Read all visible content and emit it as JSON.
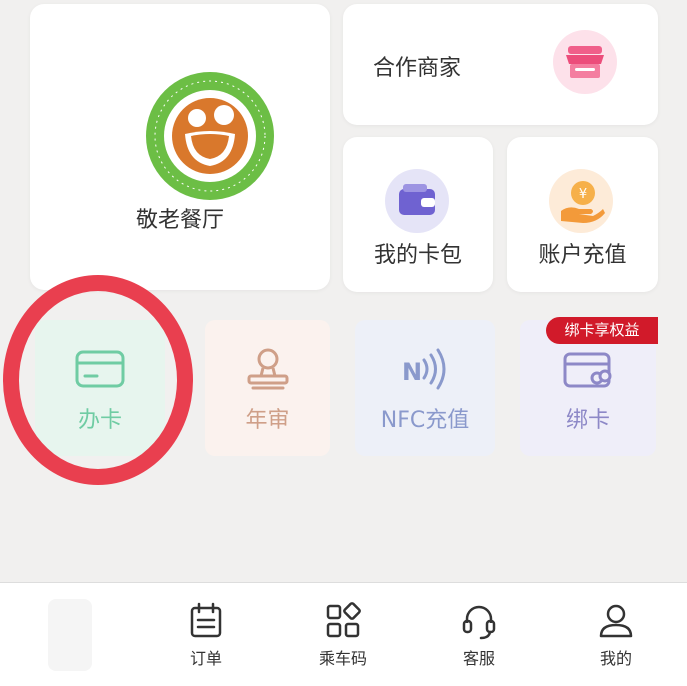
{
  "services": {
    "canteen": {
      "label": "敬老餐厅",
      "logo_icon": "elderly-canteen-logo"
    },
    "merchants": {
      "label": "合作商家",
      "icon": "shop-icon"
    },
    "wallet": {
      "label": "我的卡包",
      "icon": "wallet-icon"
    },
    "recharge": {
      "label": "账户充值",
      "icon": "coin-hand-icon"
    }
  },
  "quick_actions": {
    "apply_card": {
      "label": "办卡",
      "icon": "card-icon"
    },
    "annual_review": {
      "label": "年审",
      "icon": "stamp-icon"
    },
    "nfc_recharge": {
      "label": "NFC充值",
      "icon": "nfc-icon"
    },
    "bind_card": {
      "label": "绑卡",
      "icon": "card-link-icon"
    }
  },
  "promo_badge": "绑卡享权益",
  "tabbar": {
    "orders": {
      "label": "订单",
      "icon": "calendar-icon"
    },
    "ride_code": {
      "label": "乘车码",
      "icon": "grid-code-icon"
    },
    "service": {
      "label": "客服",
      "icon": "headset-icon"
    },
    "mine": {
      "label": "我的",
      "icon": "user-icon"
    }
  },
  "colors": {
    "highlight_circle": "#e93f4f",
    "badge": "#d11a2a",
    "apply_tint": "#6fcca3",
    "annual_tint": "#cf9f88",
    "nfc_tint": "#8a99cc",
    "bind_tint": "#8d88c7"
  }
}
